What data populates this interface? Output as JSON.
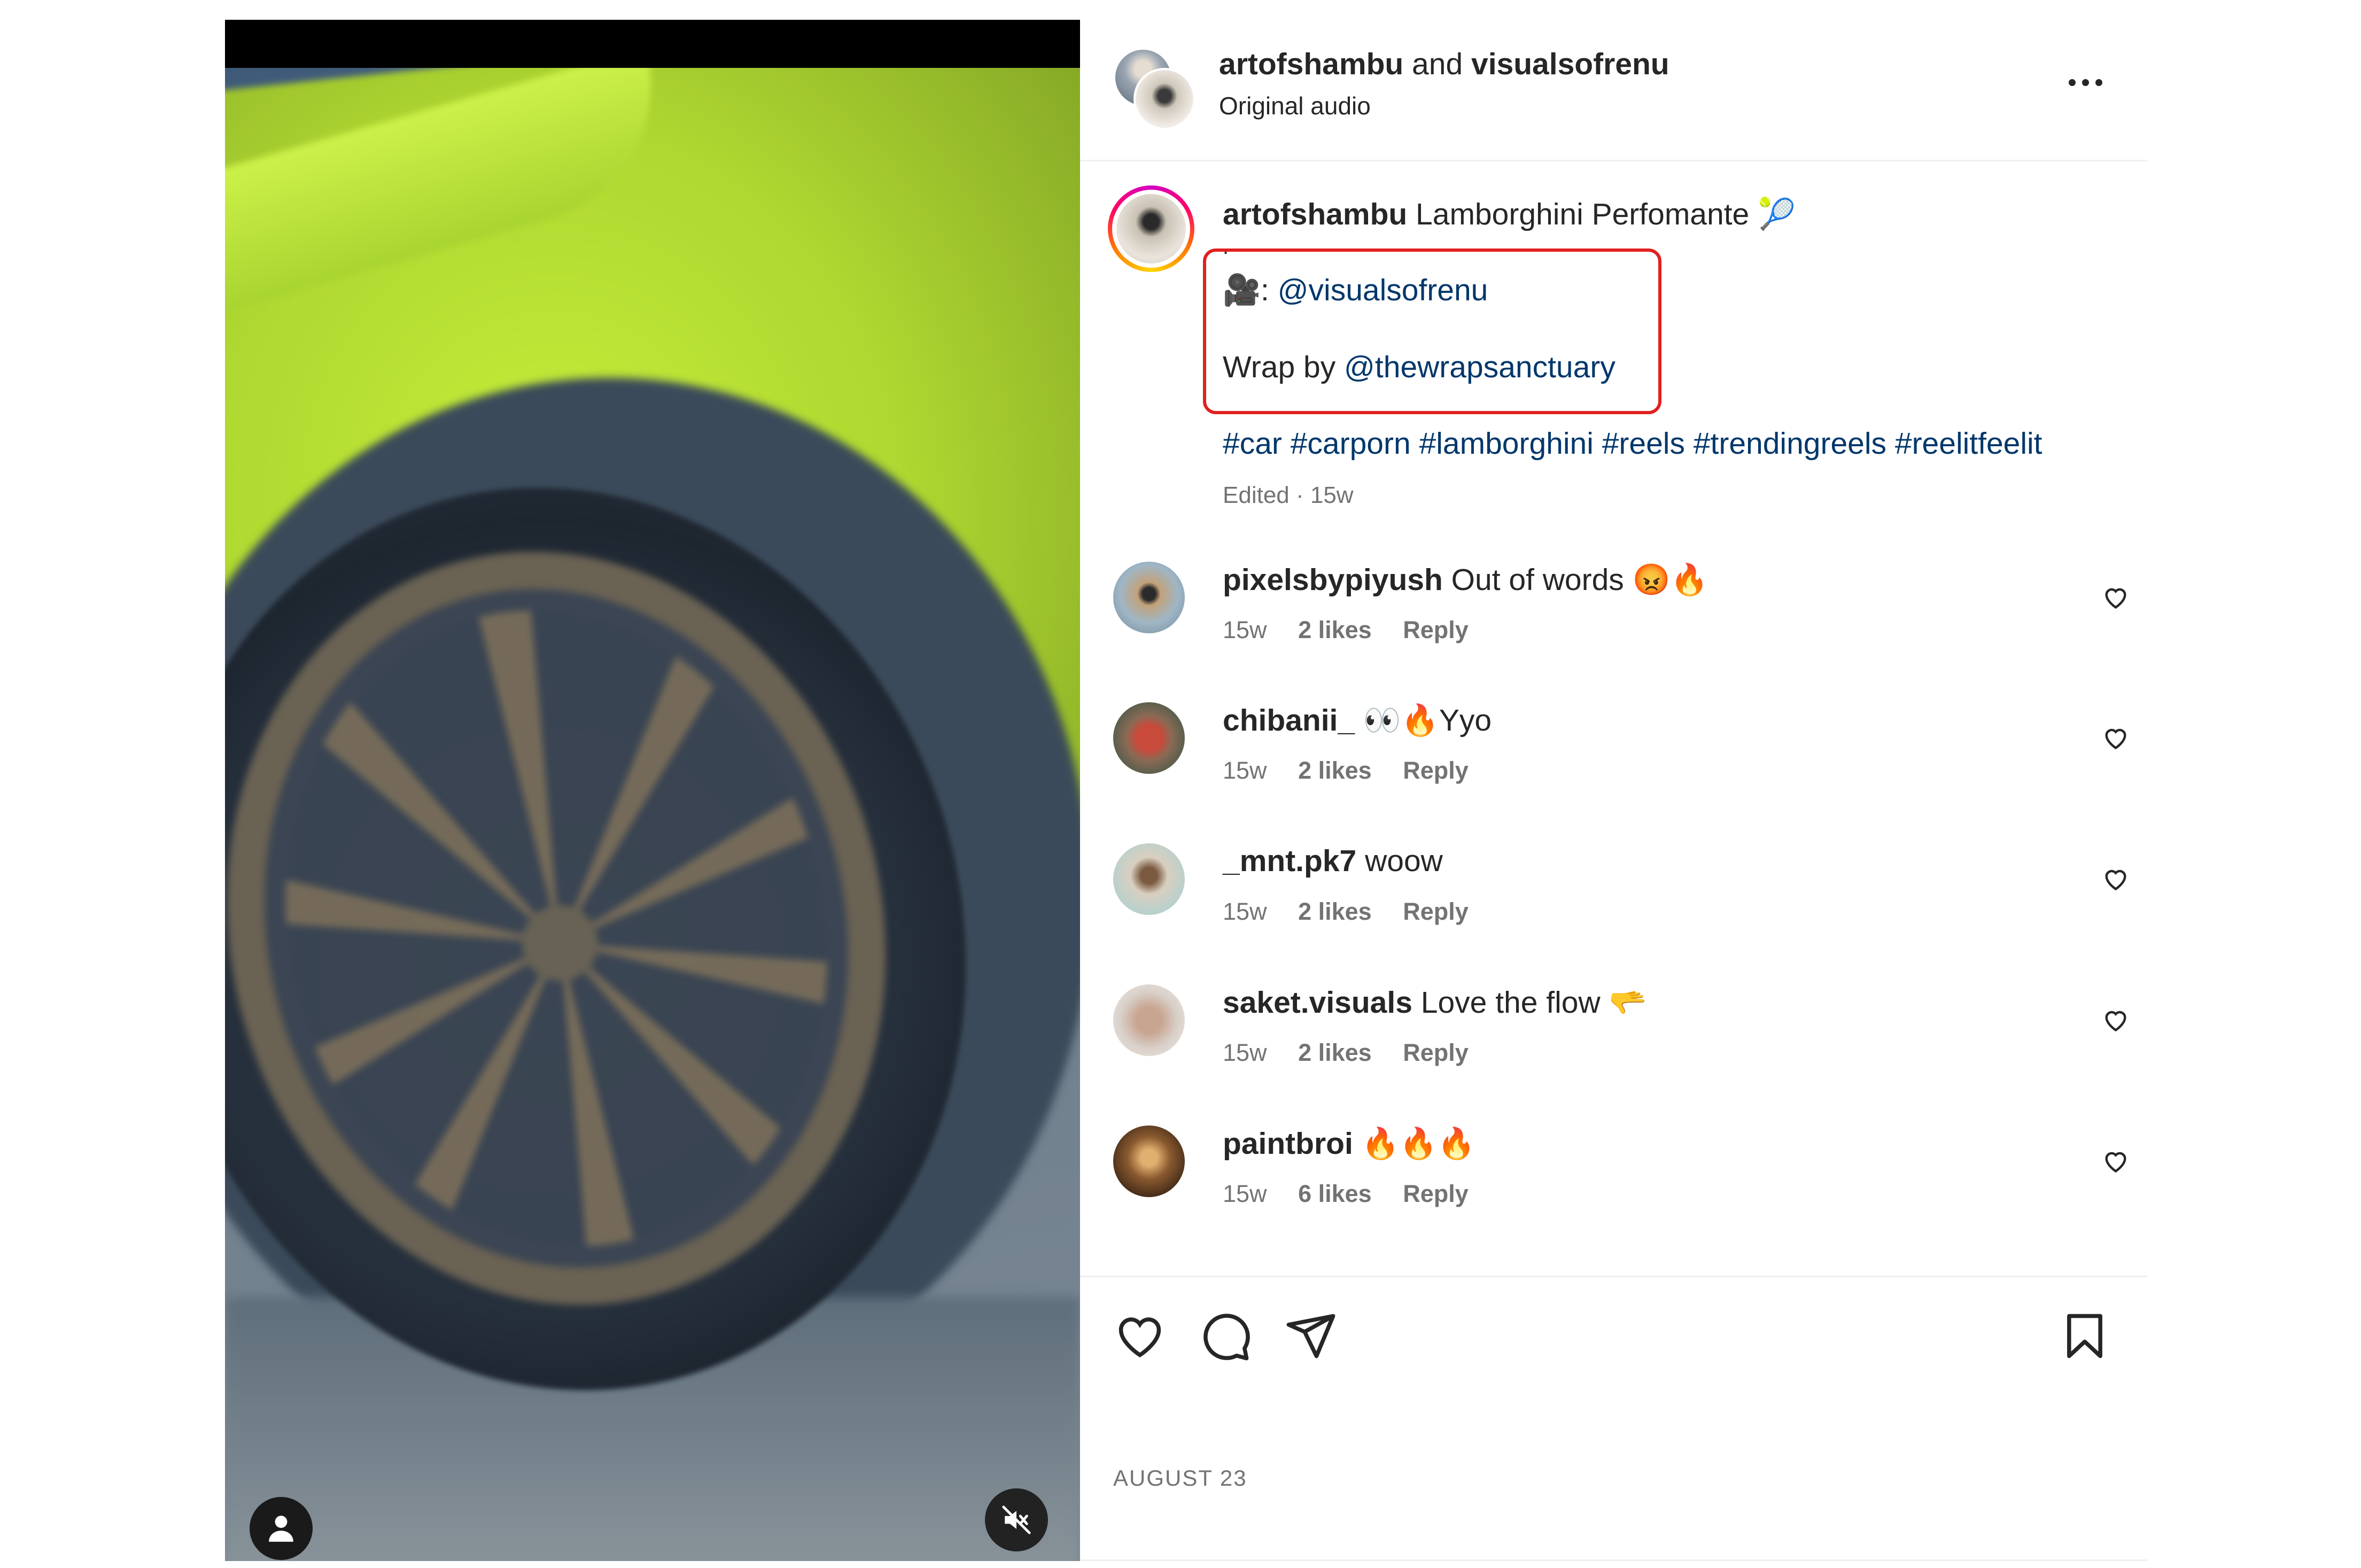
{
  "header": {
    "user1": "artofshambu",
    "and": "and",
    "user2": "visualsofrenu",
    "audio": "Original audio"
  },
  "caption": {
    "username": "artofshambu",
    "text": "Lamborghini Perfomante",
    "text_emoji": "🎾",
    "dot": ".",
    "camera_emoji": "🎥",
    "colon": ":",
    "camera_mention": "@visualsofrenu",
    "wrap_prefix": "Wrap by",
    "wrap_mention": "@thewrapsanctuary",
    "hashtags": "#car #carporn #lamborghini #reels #trendingreels #reelitfeelit",
    "edited": "Edited · 15w"
  },
  "comments": [
    {
      "username": "pixelsbypiyush",
      "text": "Out of words 😡🔥",
      "age": "15w",
      "likes": "2 likes",
      "reply": "Reply"
    },
    {
      "username": "chibanii_",
      "text": "👀🔥Yyo",
      "age": "15w",
      "likes": "2 likes",
      "reply": "Reply"
    },
    {
      "username": "_mnt.pk7",
      "text": "woow",
      "age": "15w",
      "likes": "2 likes",
      "reply": "Reply"
    },
    {
      "username": "saket.visuals",
      "text": "Love the flow 🫳",
      "age": "15w",
      "likes": "2 likes",
      "reply": "Reply"
    },
    {
      "username": "paintbroi",
      "text": "🔥🔥🔥",
      "age": "15w",
      "likes": "6 likes",
      "reply": "Reply"
    }
  ],
  "post_date": "AUGUST 23",
  "colors": {
    "link": "#00376b",
    "highlight_box": "#e0201f",
    "muted_text": "#737373"
  },
  "icons": [
    "profile-icon",
    "mute-icon",
    "more-icon",
    "heart-icon",
    "comment-icon",
    "share-icon",
    "bookmark-icon"
  ]
}
